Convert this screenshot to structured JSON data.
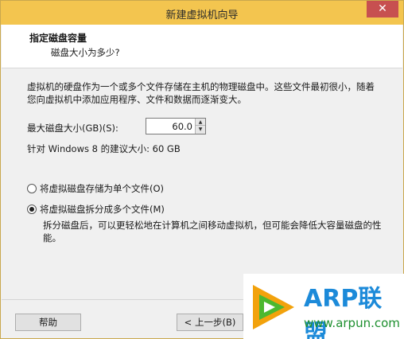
{
  "window": {
    "title": "新建虚拟机向导",
    "close_glyph": "✕"
  },
  "header": {
    "title": "指定磁盘容量",
    "subtitle": "磁盘大小为多少?"
  },
  "description": "虚拟机的硬盘作为一个或多个文件存储在主机的物理磁盘中。这些文件最初很小，随着您向虚拟机中添加应用程序、文件和数据而逐渐变大。",
  "disk_size": {
    "label": "最大磁盘大小(GB)(S):",
    "value": "60.0",
    "recommendation": "针对 Windows 8 的建议大小: 60 GB"
  },
  "storage_options": {
    "single_file": "将虚拟磁盘存储为单个文件(O)",
    "split_files": "将虚拟磁盘拆分成多个文件(M)",
    "split_note": "拆分磁盘后，可以更轻松地在计算机之间移动虚拟机，但可能会降低大容量磁盘的性能。",
    "selected": "split_files"
  },
  "buttons": {
    "help": "帮助",
    "back": "< 上一步(B)"
  },
  "watermark": {
    "title": "ARP联盟",
    "url": "www.arpun.com"
  },
  "colors": {
    "titlebar": "#f3c54f",
    "close": "#c75050",
    "wm_blue": "#1c8ad9",
    "wm_green": "#1d8f2e"
  }
}
